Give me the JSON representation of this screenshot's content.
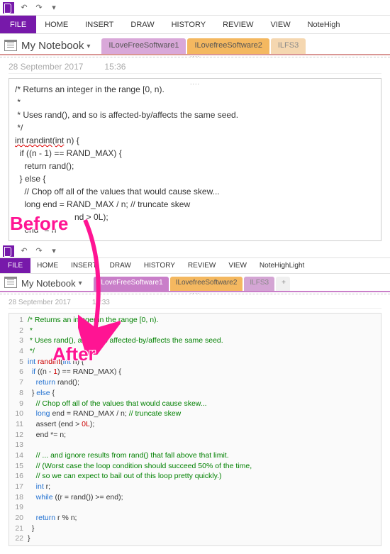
{
  "qat": {
    "undo": "↶",
    "redo": "↷",
    "down": "▾"
  },
  "ribbon": {
    "file": "FILE",
    "home": "HOME",
    "insert": "INSERT",
    "draw": "DRAW",
    "history": "HISTORY",
    "review": "REVIEW",
    "view": "VIEW",
    "plugin": "NoteHigh",
    "plugin2": "NoteHighLight"
  },
  "notebook": {
    "title": "My Notebook",
    "drop": "▾"
  },
  "tabs": {
    "t1": "ILoveFreeSoftware1",
    "t2": "ILovefreeSoftware2",
    "t3": "ILFS3",
    "add": "+"
  },
  "before": {
    "date": "28 September 2017",
    "time": "15:36",
    "l1": "/* Returns an integer in the range [0, n).",
    "l2": " *",
    "l3": " * Uses rand(), and so is affected-by/affects the same seed.",
    "l4": " */",
    "l5": "int ",
    "l5b": "randint",
    "l5c": "(",
    "l5d": "int",
    "l5e": " n) {",
    "l6": "  if ((n - 1) == RAND_MAX) {",
    "l7": "    return rand();",
    "l8": "  } else {",
    "l9": "    // Chop off all of the values that would cause skew...",
    "l10": "    long end = RAND_MAX / n; // truncate skew",
    "l11a": "nd > 0L);",
    "l12": "    end *= n"
  },
  "labels": {
    "before": "Before",
    "after": "After"
  },
  "after": {
    "date": "28 September 2017",
    "time": "15:33",
    "rows": [
      {
        "n": "1",
        "seg": [
          {
            "c": "cmt",
            "t": "/* Returns an integer in the range [0, n)."
          }
        ]
      },
      {
        "n": "2",
        "seg": [
          {
            "c": "cmt",
            "t": " *"
          }
        ]
      },
      {
        "n": "3",
        "seg": [
          {
            "c": "cmt",
            "t": " * Uses rand(), and so is affected-by/affects the same seed."
          }
        ]
      },
      {
        "n": "4",
        "seg": [
          {
            "c": "cmt",
            "t": " */"
          }
        ]
      },
      {
        "n": "5",
        "seg": [
          {
            "c": "kw",
            "t": "int"
          },
          {
            "c": "",
            "t": " "
          },
          {
            "c": "fn",
            "t": "randint"
          },
          {
            "c": "",
            "t": "("
          },
          {
            "c": "kw",
            "t": "int"
          },
          {
            "c": "",
            "t": " n) {"
          }
        ]
      },
      {
        "n": "6",
        "seg": [
          {
            "c": "",
            "t": "  "
          },
          {
            "c": "kw",
            "t": "if"
          },
          {
            "c": "",
            "t": " ((n - "
          },
          {
            "c": "num",
            "t": "1"
          },
          {
            "c": "",
            "t": ") == RAND_MAX) {"
          }
        ]
      },
      {
        "n": "7",
        "seg": [
          {
            "c": "",
            "t": "    "
          },
          {
            "c": "kw",
            "t": "return"
          },
          {
            "c": "",
            "t": " rand();"
          }
        ]
      },
      {
        "n": "8",
        "seg": [
          {
            "c": "",
            "t": "  } "
          },
          {
            "c": "kw",
            "t": "else"
          },
          {
            "c": "",
            "t": " {"
          }
        ]
      },
      {
        "n": "9",
        "seg": [
          {
            "c": "",
            "t": "    "
          },
          {
            "c": "cmt",
            "t": "// Chop off all of the values that would cause skew..."
          }
        ]
      },
      {
        "n": "10",
        "seg": [
          {
            "c": "",
            "t": "    "
          },
          {
            "c": "kw",
            "t": "long"
          },
          {
            "c": "",
            "t": " end = RAND_MAX / n; "
          },
          {
            "c": "cmt",
            "t": "// truncate skew"
          }
        ]
      },
      {
        "n": "11",
        "seg": [
          {
            "c": "",
            "t": "    assert (end > "
          },
          {
            "c": "num",
            "t": "0L"
          },
          {
            "c": "",
            "t": ");"
          }
        ]
      },
      {
        "n": "12",
        "seg": [
          {
            "c": "",
            "t": "    end *= n;"
          }
        ]
      },
      {
        "n": "13",
        "seg": [
          {
            "c": "",
            "t": ""
          }
        ]
      },
      {
        "n": "14",
        "seg": [
          {
            "c": "",
            "t": "    "
          },
          {
            "c": "cmt",
            "t": "// ... and ignore results from rand() that fall above that limit."
          }
        ]
      },
      {
        "n": "15",
        "seg": [
          {
            "c": "",
            "t": "    "
          },
          {
            "c": "cmt",
            "t": "// (Worst case the loop condition should succeed 50% of the time,"
          }
        ]
      },
      {
        "n": "16",
        "seg": [
          {
            "c": "",
            "t": "    "
          },
          {
            "c": "cmt",
            "t": "// so we can expect to bail out of this loop pretty quickly.)"
          }
        ]
      },
      {
        "n": "17",
        "seg": [
          {
            "c": "",
            "t": "    "
          },
          {
            "c": "kw",
            "t": "int"
          },
          {
            "c": "",
            "t": " r;"
          }
        ]
      },
      {
        "n": "18",
        "seg": [
          {
            "c": "",
            "t": "    "
          },
          {
            "c": "kw",
            "t": "while"
          },
          {
            "c": "",
            "t": " ((r = rand()) >= end);"
          }
        ]
      },
      {
        "n": "19",
        "seg": [
          {
            "c": "",
            "t": ""
          }
        ]
      },
      {
        "n": "20",
        "seg": [
          {
            "c": "",
            "t": "    "
          },
          {
            "c": "kw",
            "t": "return"
          },
          {
            "c": "",
            "t": " r % n;"
          }
        ]
      },
      {
        "n": "21",
        "seg": [
          {
            "c": "",
            "t": "  }"
          }
        ]
      },
      {
        "n": "22",
        "seg": [
          {
            "c": "",
            "t": "}"
          }
        ]
      }
    ]
  }
}
